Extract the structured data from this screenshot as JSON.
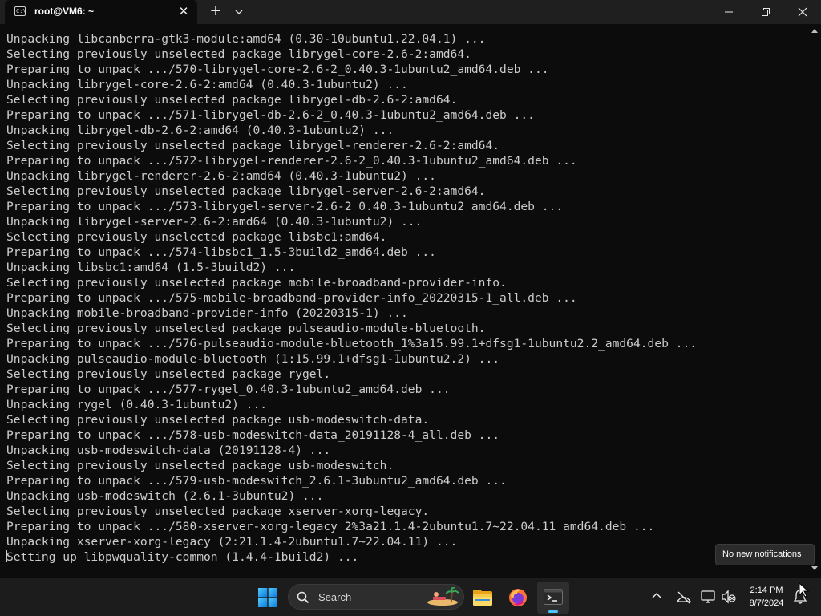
{
  "window": {
    "tab_title": "root@VM6: ~",
    "tab_icon_glyph": "C:\\",
    "new_tab_glyph": "+",
    "tab_close_glyph": "✕"
  },
  "terminal": {
    "lines": [
      "Unpacking libcanberra-gtk3-module:amd64 (0.30-10ubuntu1.22.04.1) ...",
      "Selecting previously unselected package librygel-core-2.6-2:amd64.",
      "Preparing to unpack .../570-librygel-core-2.6-2_0.40.3-1ubuntu2_amd64.deb ...",
      "Unpacking librygel-core-2.6-2:amd64 (0.40.3-1ubuntu2) ...",
      "Selecting previously unselected package librygel-db-2.6-2:amd64.",
      "Preparing to unpack .../571-librygel-db-2.6-2_0.40.3-1ubuntu2_amd64.deb ...",
      "Unpacking librygel-db-2.6-2:amd64 (0.40.3-1ubuntu2) ...",
      "Selecting previously unselected package librygel-renderer-2.6-2:amd64.",
      "Preparing to unpack .../572-librygel-renderer-2.6-2_0.40.3-1ubuntu2_amd64.deb ...",
      "Unpacking librygel-renderer-2.6-2:amd64 (0.40.3-1ubuntu2) ...",
      "Selecting previously unselected package librygel-server-2.6-2:amd64.",
      "Preparing to unpack .../573-librygel-server-2.6-2_0.40.3-1ubuntu2_amd64.deb ...",
      "Unpacking librygel-server-2.6-2:amd64 (0.40.3-1ubuntu2) ...",
      "Selecting previously unselected package libsbc1:amd64.",
      "Preparing to unpack .../574-libsbc1_1.5-3build2_amd64.deb ...",
      "Unpacking libsbc1:amd64 (1.5-3build2) ...",
      "Selecting previously unselected package mobile-broadband-provider-info.",
      "Preparing to unpack .../575-mobile-broadband-provider-info_20220315-1_all.deb ...",
      "Unpacking mobile-broadband-provider-info (20220315-1) ...",
      "Selecting previously unselected package pulseaudio-module-bluetooth.",
      "Preparing to unpack .../576-pulseaudio-module-bluetooth_1%3a15.99.1+dfsg1-1ubuntu2.2_amd64.deb ...",
      "Unpacking pulseaudio-module-bluetooth (1:15.99.1+dfsg1-1ubuntu2.2) ...",
      "Selecting previously unselected package rygel.",
      "Preparing to unpack .../577-rygel_0.40.3-1ubuntu2_amd64.deb ...",
      "Unpacking rygel (0.40.3-1ubuntu2) ...",
      "Selecting previously unselected package usb-modeswitch-data.",
      "Preparing to unpack .../578-usb-modeswitch-data_20191128-4_all.deb ...",
      "Unpacking usb-modeswitch-data (20191128-4) ...",
      "Selecting previously unselected package usb-modeswitch.",
      "Preparing to unpack .../579-usb-modeswitch_2.6.1-3ubuntu2_amd64.deb ...",
      "Unpacking usb-modeswitch (2.6.1-3ubuntu2) ...",
      "Selecting previously unselected package xserver-xorg-legacy.",
      "Preparing to unpack .../580-xserver-xorg-legacy_2%3a21.1.4-2ubuntu1.7~22.04.11_amd64.deb ...",
      "Unpacking xserver-xorg-legacy (2:21.1.4-2ubuntu1.7~22.04.11) ...",
      "Setting up libpwquality-common (1.4.4-1build2) ..."
    ],
    "colors": {
      "background": "#0c0c0c",
      "foreground": "#cccccc"
    }
  },
  "notification_tooltip": "No new notifications",
  "taskbar": {
    "search_placeholder": "Search",
    "pinned_apps": [
      "windows-start-icon",
      "file-explorer-icon",
      "firefox-icon",
      "terminal-icon"
    ],
    "active_app": "terminal-icon",
    "accent": "#4cc2ff",
    "tray_icons": [
      "chevron-up-icon",
      "network-disconnected-icon",
      "display-icon",
      "volume-muted-icon",
      "notification-bell-icon"
    ],
    "clock_time": "2:14 PM",
    "clock_date": "8/7/2024"
  }
}
